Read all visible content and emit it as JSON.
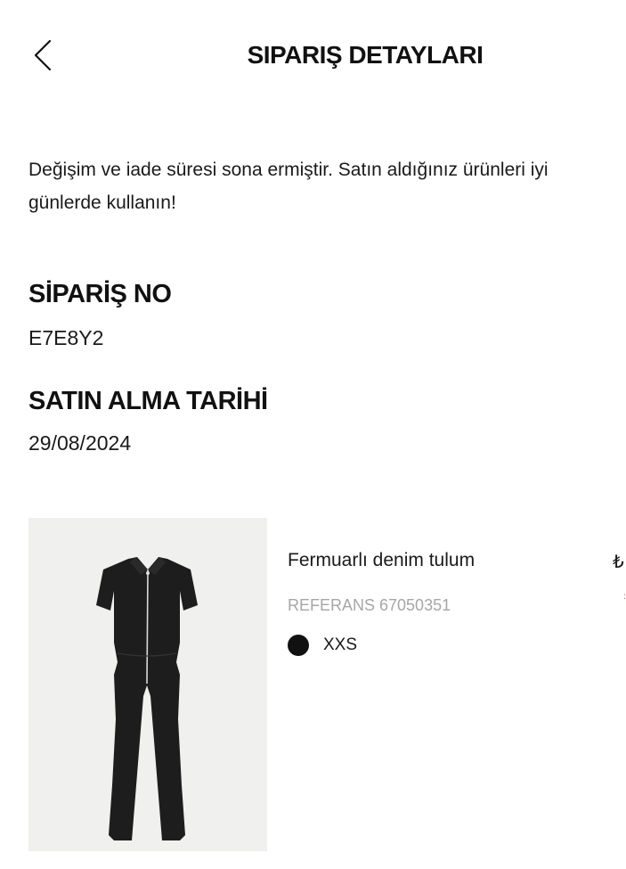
{
  "header": {
    "title": "SIPARIŞ DETAYLARI",
    "back_icon": "chevron-left-icon"
  },
  "notice": "Değişim ve iade süresi sona ermiştir. Satın aldığınız ürünleri iyi günlerde kullanın!",
  "order": {
    "number_label": "SİPARİŞ NO",
    "number_value": "E7E8Y2",
    "date_label": "SATIN ALMA TARİHİ",
    "date_value": "29/08/2024"
  },
  "product": {
    "name": "Fermuarlı denim tulum",
    "reference": "REFERANS 67050351",
    "color_hex": "#111111",
    "size": "XXS",
    "price_partial": "₺",
    "price_mark_partial": ":"
  },
  "colors": {
    "text": "#1a1a1a",
    "muted": "#a6a6a6",
    "image_bg": "#f0f0ef"
  }
}
